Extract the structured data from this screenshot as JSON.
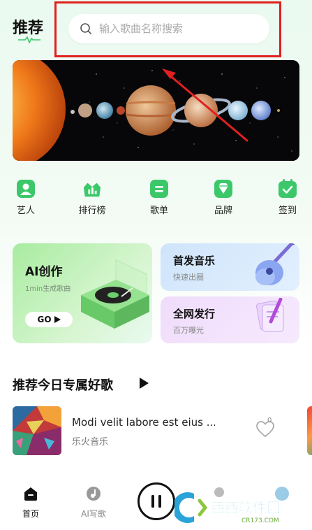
{
  "header": {
    "title": "推荐",
    "search_placeholder": "输入歌曲名称搜索"
  },
  "nav": [
    {
      "label": "艺人",
      "icon": "artist-icon"
    },
    {
      "label": "排行榜",
      "icon": "ranking-icon"
    },
    {
      "label": "歌单",
      "icon": "playlist-icon"
    },
    {
      "label": "品牌",
      "icon": "brand-icon"
    },
    {
      "label": "签到",
      "icon": "checkin-icon"
    }
  ],
  "cards": {
    "ai": {
      "title": "AI创作",
      "subtitle": "1min生成歌曲",
      "button": "GO"
    },
    "music": {
      "title": "首发音乐",
      "subtitle": "快速出圈"
    },
    "publish": {
      "title": "全网发行",
      "subtitle": "百万曝光"
    }
  },
  "recommend": {
    "section_title": "推荐今日专属好歌",
    "song": {
      "title": "Modi velit labore est eius ...",
      "artist": "乐火音乐",
      "likes": "0"
    }
  },
  "tabbar": [
    {
      "label": "首页",
      "active": true
    },
    {
      "label": "AI写歌",
      "active": false
    }
  ],
  "watermark": {
    "text": "西西软件园",
    "url_text": "CR173.COM"
  },
  "colors": {
    "accent": "#3cc86a",
    "annotation": "#e02020"
  }
}
